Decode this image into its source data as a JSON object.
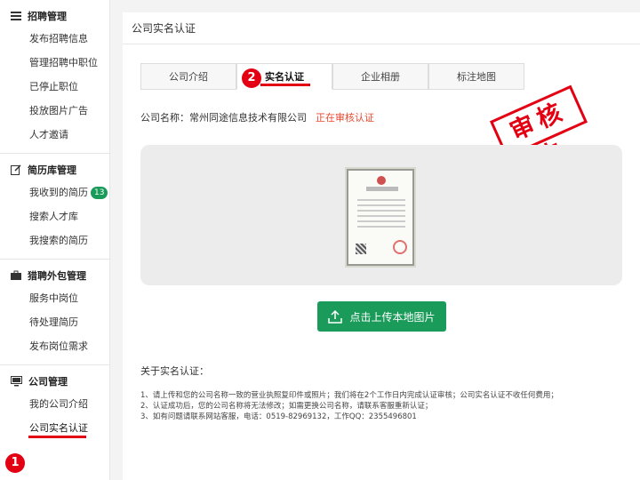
{
  "sidebar": {
    "groups": [
      {
        "title": "招聘管理",
        "icon": "list-icon",
        "items": [
          "发布招聘信息",
          "管理招聘中职位",
          "已停止职位",
          "投放图片广告",
          "人才邀请"
        ]
      },
      {
        "title": "简历库管理",
        "icon": "edit-icon",
        "items": [
          "我收到的简历",
          "搜索人才库",
          "我搜索的简历"
        ],
        "badge": "13"
      },
      {
        "title": "猎聘外包管理",
        "icon": "briefcase-icon",
        "items": [
          "服务中岗位",
          "待处理简历",
          "发布岗位需求"
        ]
      },
      {
        "title": "公司管理",
        "icon": "monitor-icon",
        "items": [
          "我的公司介绍",
          "公司实名认证"
        ]
      }
    ],
    "step_marker": "1"
  },
  "main": {
    "header_title": "公司实名认证",
    "tabs": [
      "公司介绍",
      "实名认证",
      "企业相册",
      "标注地图"
    ],
    "active_tab": "实名认证",
    "step_marker": "2",
    "company_label": "公司名称：",
    "company_name": "常州同途信息技术有限公司",
    "status": "正在审核认证",
    "stamp_text": "审核中",
    "upload_button": "点击上传本地图片",
    "about_title": "关于实名认证：",
    "about_items": [
      "1、请上传和您的公司名称一致的营业执照复印件或照片；我们将在2个工作日内完成认证审核；公司实名认证不收任何费用；",
      "2、认证成功后，您的公司名称将无法修改；如需更换公司名称，请联系客服重新认证；",
      "3、如有问题请联系网站客服，电话：0519-82969132，工作QQ：2355496801"
    ]
  },
  "colors": {
    "accent_green": "#1a9b5a",
    "alert_red": "#e30012",
    "status_orange": "#e8492f"
  }
}
